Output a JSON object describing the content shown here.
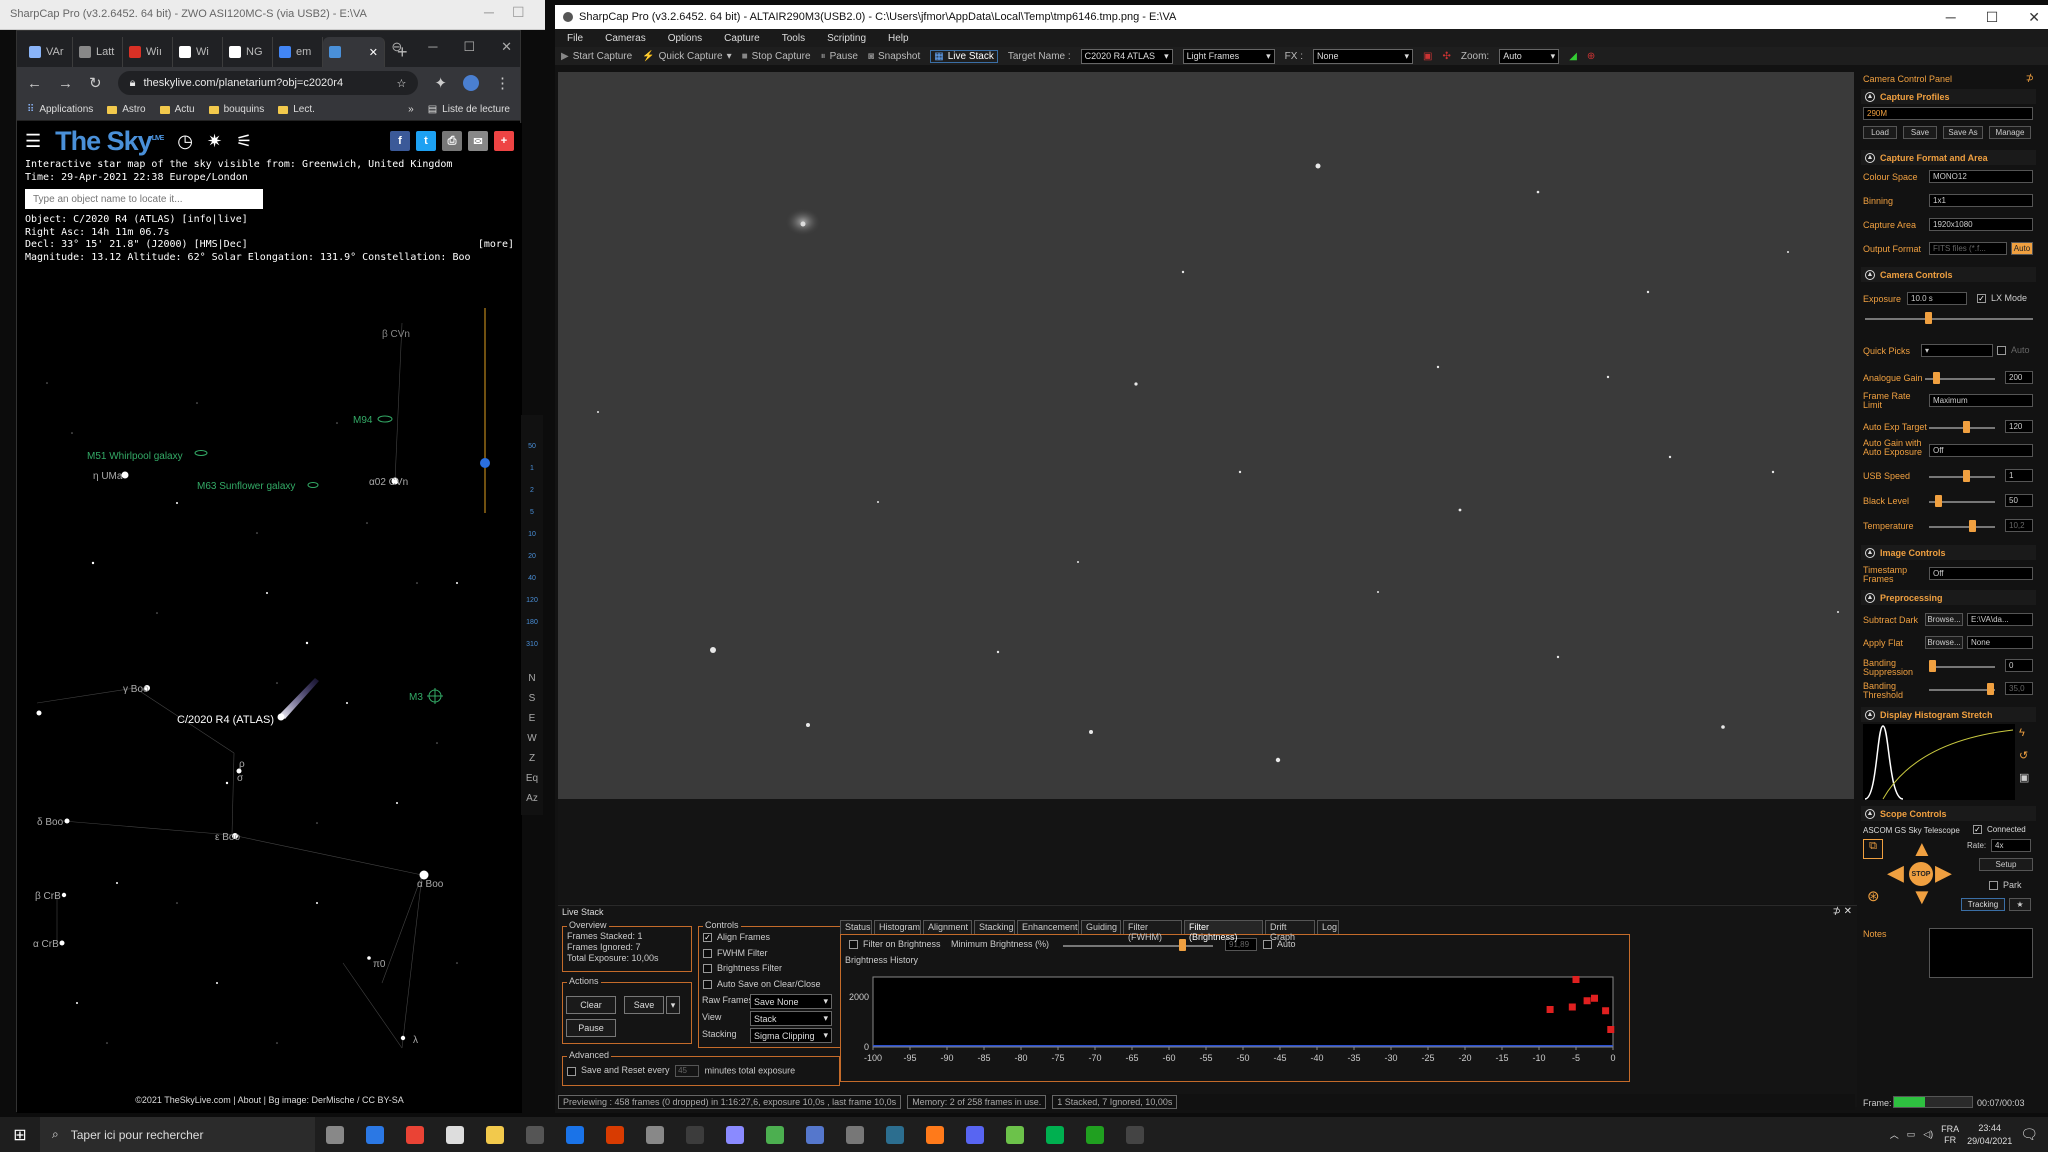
{
  "bg_window": {
    "title": "SharpCap Pro (v3.2.6452. 64 bit) - ZWO ASI120MC-S (via USB2) - E:\\VA"
  },
  "browser": {
    "tabs": [
      {
        "label": "VAr",
        "color": "#8ab4f8"
      },
      {
        "label": "Latt",
        "color": "#888888"
      },
      {
        "label": "Wiı",
        "color": "#d93025"
      },
      {
        "label": "Wi",
        "color": "#ffffff"
      },
      {
        "label": "NG",
        "color": "#ffffff"
      },
      {
        "label": "em",
        "color": "#4285f4"
      },
      {
        "label": "",
        "color": "#4a90d9"
      }
    ],
    "url": "theskylive.com/planetarium?obj=c2020r4",
    "bookmarks": [
      "Applications",
      "Astro",
      "Actu",
      "bouquins",
      "Lect."
    ],
    "reading_list": "Liste de lecture"
  },
  "sky": {
    "logo": "The Sky",
    "logo_sup": "LIVE",
    "info_line1": "Interactive star map of the sky visible from: Greenwich, United Kingdom",
    "info_line2": "Time: 29-Apr-2021 22:38 Europe/London",
    "search_placeholder": "Type an object name to locate it...",
    "more": "[more]",
    "object_lines": [
      "Object: C/2020 R4 (ATLAS) [info|live]",
      "Right Asc: 14h 11m 06.7s",
      "Decl: 33° 15' 21.8\" (J2000) [HMS|Dec]",
      "Magnitude: 13.12 Altitude: 62° Solar Elongation: 131.9° Constellation: Boo"
    ],
    "labels": {
      "bcvn": "β CVn",
      "m94": "M94",
      "m51": "M51 Whirlpool galaxy",
      "eta_uma": "η UMa",
      "m63": "M63 Sunflower galaxy",
      "a02cvn": "α02 CVn",
      "gboo": "γ Boo",
      "comet": "C/2020 R4 (ATLAS)",
      "m3": "M3",
      "rho": "ρ",
      "sigma": "σ",
      "dboo": "δ Boo",
      "eboo": "ε Boo",
      "aboo": "α Boo",
      "bcrb": "β CrB",
      "acrb": "α CrB",
      "pi": "π0",
      "lambda": "λ"
    },
    "side_tools": [
      "N",
      "S",
      "E",
      "W",
      "Z",
      "Eq",
      "Az"
    ],
    "zoom_ticks": [
      "50",
      "1",
      "2",
      "5",
      "10",
      "20",
      "40",
      "120",
      "180",
      "310"
    ],
    "copyright": "©2021 TheSkyLive.com | About | Bg image: DerMische / CC BY-SA"
  },
  "sharpcap": {
    "title": "SharpCap Pro (v3.2.6452. 64 bit) - ALTAIR290M3(USB2.0) - C:\\Users\\jfmor\\AppData\\Local\\Temp\\tmp6146.tmp.png - E:\\VA",
    "menu": [
      "File",
      "Cameras",
      "Options",
      "Capture",
      "Tools",
      "Scripting",
      "Help"
    ],
    "toolbar": {
      "start": "Start Capture",
      "quick": "Quick Capture",
      "stop": "Stop Capture",
      "pause": "Pause",
      "snapshot": "Snapshot",
      "live": "Live Stack",
      "target_label": "Target Name :",
      "target": "C2020 R4 ATLAS",
      "frames": "Light Frames",
      "fx_label": "FX :",
      "fx": "None",
      "zoom_label": "Zoom:",
      "zoom": "Auto"
    },
    "livestack": {
      "title": "Live Stack",
      "overview_title": "Overview",
      "frames_stacked": "Frames Stacked:  1",
      "frames_ignored": "Frames Ignored:  7",
      "total_exposure": "Total Exposure:   10,00s",
      "actions_title": "Actions",
      "clear": "Clear",
      "save": "Save",
      "pause": "Pause",
      "controls_title": "Controls",
      "align": "Align Frames",
      "fwhm": "FWHM Filter",
      "brightness": "Brightness Filter",
      "autosave": "Auto Save on Clear/Close",
      "raw_label": "Raw Frames",
      "raw": "Save None",
      "view_label": "View",
      "view": "Stack",
      "stacking_label": "Stacking",
      "stacking": "Sigma Clipping",
      "advanced_title": "Advanced",
      "save_reset": "Save and Reset every",
      "minutes": "45",
      "minutes_suffix": "minutes total exposure",
      "tabs": [
        "Status",
        "Histogram",
        "Alignment",
        "Stacking",
        "Enhancement",
        "Guiding",
        "Filter (FWHM)",
        "Filter (Brightness)",
        "Drift Graph",
        "Log"
      ],
      "filter_on": "Filter on Brightness",
      "min_brightness": "Minimum Brightness (%)",
      "min_value": "91,89",
      "auto": "Auto",
      "history_title": "Brightness History"
    },
    "status": [
      "Previewing : 458 frames (0 dropped) in 1:16:27,6, exposure 10,0s , last frame 10,0s",
      "Memory: 2 of 258 frames in use.",
      "1 Stacked, 7 Ignored, 10,00s"
    ],
    "frame_label": "Frame:",
    "frame_time": "00:07/00:03"
  },
  "chart_data": {
    "type": "scatter",
    "title": "Brightness History",
    "xlim": [
      -100,
      0
    ],
    "ylim": [
      0,
      2800
    ],
    "x_ticks": [
      -100,
      -95,
      -90,
      -85,
      -80,
      -75,
      -70,
      -65,
      -60,
      -55,
      -50,
      -45,
      -40,
      -35,
      -30,
      -25,
      -20,
      -15,
      -10,
      -5,
      0
    ],
    "y_ticks": [
      0,
      2000
    ],
    "points": [
      {
        "x": -8.5,
        "y": 1500
      },
      {
        "x": -5.5,
        "y": 1600
      },
      {
        "x": -5,
        "y": 2700
      },
      {
        "x": -3.5,
        "y": 1850
      },
      {
        "x": -2.5,
        "y": 1950
      },
      {
        "x": -1,
        "y": 1450
      },
      {
        "x": -0.3,
        "y": 700
      }
    ],
    "threshold": 50,
    "point_color": "#e02020",
    "threshold_color": "#2a4fd0"
  },
  "panel": {
    "title": "Camera Control Panel",
    "capture_profiles": "Capture Profiles",
    "profile": "290M",
    "load": "Load",
    "save": "Save",
    "save_as": "Save As",
    "manage": "Manage",
    "format_title": "Capture Format and Area",
    "colour_space": "Colour Space",
    "colour_value": "MONO12",
    "binning": "Binning",
    "binning_value": "1x1",
    "area": "Capture Area",
    "area_value": "1920x1080",
    "output": "Output Format",
    "output_value": "FITS files (*.f...",
    "auto": "Auto",
    "camera_title": "Camera Controls",
    "exposure": "Exposure",
    "exposure_value": "10.0 s",
    "lx": "LX Mode",
    "quick_picks": "Quick Picks",
    "gain": "Analogue Gain",
    "gain_value": "200",
    "frame_rate": "Frame Rate Limit",
    "frame_rate_value": "Maximum",
    "auto_exp": "Auto Exp Target",
    "auto_exp_value": "120",
    "auto_gain": "Auto Gain with Auto Exposure",
    "auto_gain_value": "Off",
    "usb": "USB Speed",
    "usb_value": "1",
    "black": "Black Level",
    "black_value": "50",
    "temp": "Temperature",
    "temp_value": "10,2",
    "image_title": "Image Controls",
    "timestamp": "Timestamp Frames",
    "timestamp_value": "Off",
    "pre_title": "Preprocessing",
    "subtract": "Subtract Dark",
    "browse": "Browse...",
    "dark_value": "E:\\VA\\da...",
    "flat": "Apply Flat",
    "flat_value": "None",
    "banding": "Banding Suppression",
    "banding_value": "0",
    "banding_t": "Banding Threshold",
    "banding_t_value": "35,0",
    "hist_title": "Display Histogram Stretch",
    "scope_title": "Scope Controls",
    "telescope": "ASCOM GS Sky Telescope",
    "connected": "Connected",
    "rate": "Rate:",
    "rate_value": "4x",
    "setup": "Setup",
    "park": "Park",
    "tracking": "Tracking",
    "stop": "STOP",
    "notes": "Notes"
  },
  "taskbar": {
    "search": "Taper ici pour rechercher",
    "lang": "FRA",
    "lang2": "FR",
    "time": "23:44",
    "date": "29/04/2021"
  }
}
